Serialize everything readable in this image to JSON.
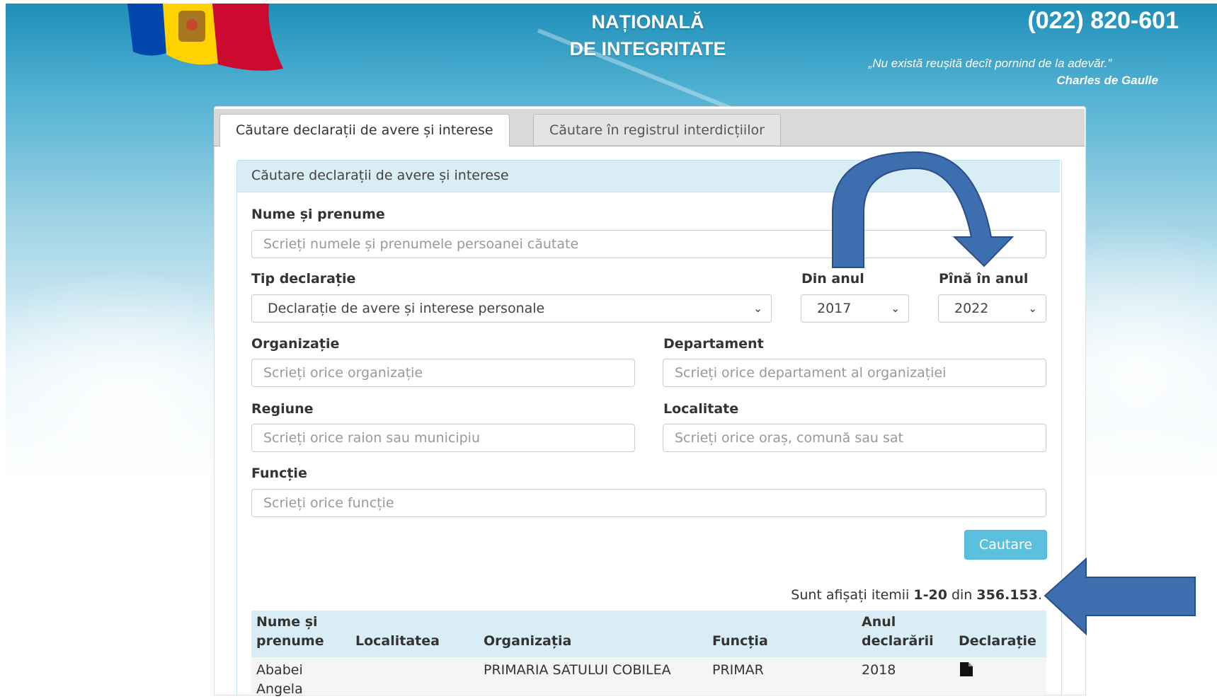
{
  "header": {
    "title_line1": "NAȚIONALĂ",
    "title_line2": "DE INTEGRITATE",
    "phone": "(022) 820-601",
    "quote": "„Nu există reușită decît pornind de la adevăr.”",
    "quote_author": "Charles de Gaulle"
  },
  "tabs": [
    {
      "label": "Căutare declarații de avere și interese",
      "active": true
    },
    {
      "label": "Căutare în registrul interdicțiilor",
      "active": false
    }
  ],
  "search": {
    "heading": "Căutare declarații de avere și interese",
    "name_label": "Nume și prenume",
    "name_placeholder": "Scrieți numele și prenumele persoanei căutate",
    "type_label": "Tip declarație",
    "type_value": "Declarație de avere și interese personale",
    "from_label": "Din anul",
    "from_value": "2017",
    "to_label": "Pînă în anul",
    "to_value": "2022",
    "org_label": "Organizație",
    "org_placeholder": "Scrieți orice organizație",
    "dept_label": "Departament",
    "dept_placeholder": "Scrieți orice departament al organizației",
    "region_label": "Regiune",
    "region_placeholder": "Scrieți orice raion sau municipiu",
    "locality_label": "Localitate",
    "locality_placeholder": "Scrieți orice oraș, comună sau sat",
    "function_label": "Funcție",
    "function_placeholder": "Scrieți orice funcție",
    "button_label": "Cautare"
  },
  "results": {
    "prefix": "Sunt afișați itemii",
    "range": "1-20",
    "middle": "din",
    "total": "356.153",
    "suffix": "."
  },
  "table": {
    "headers": {
      "name_line1": "Nume și",
      "name_line2": "prenume",
      "locality": "Localitatea",
      "organization": "Organizația",
      "function": "Funcția",
      "year_line1": "Anul",
      "year_line2": "declarării",
      "declaration": "Declarație"
    },
    "rows": [
      {
        "name_line1": "Ababei",
        "name_line2": "Angela",
        "locality": "",
        "organization": "PRIMARIA SATULUI COBILEA",
        "function": "PRIMAR",
        "year": "2018",
        "declaration_icon": "file-icon"
      }
    ]
  },
  "colors": {
    "accent_button": "#5bc0de",
    "panel_heading": "#d9edf7",
    "annotation_arrow": "#3d6fb0"
  }
}
